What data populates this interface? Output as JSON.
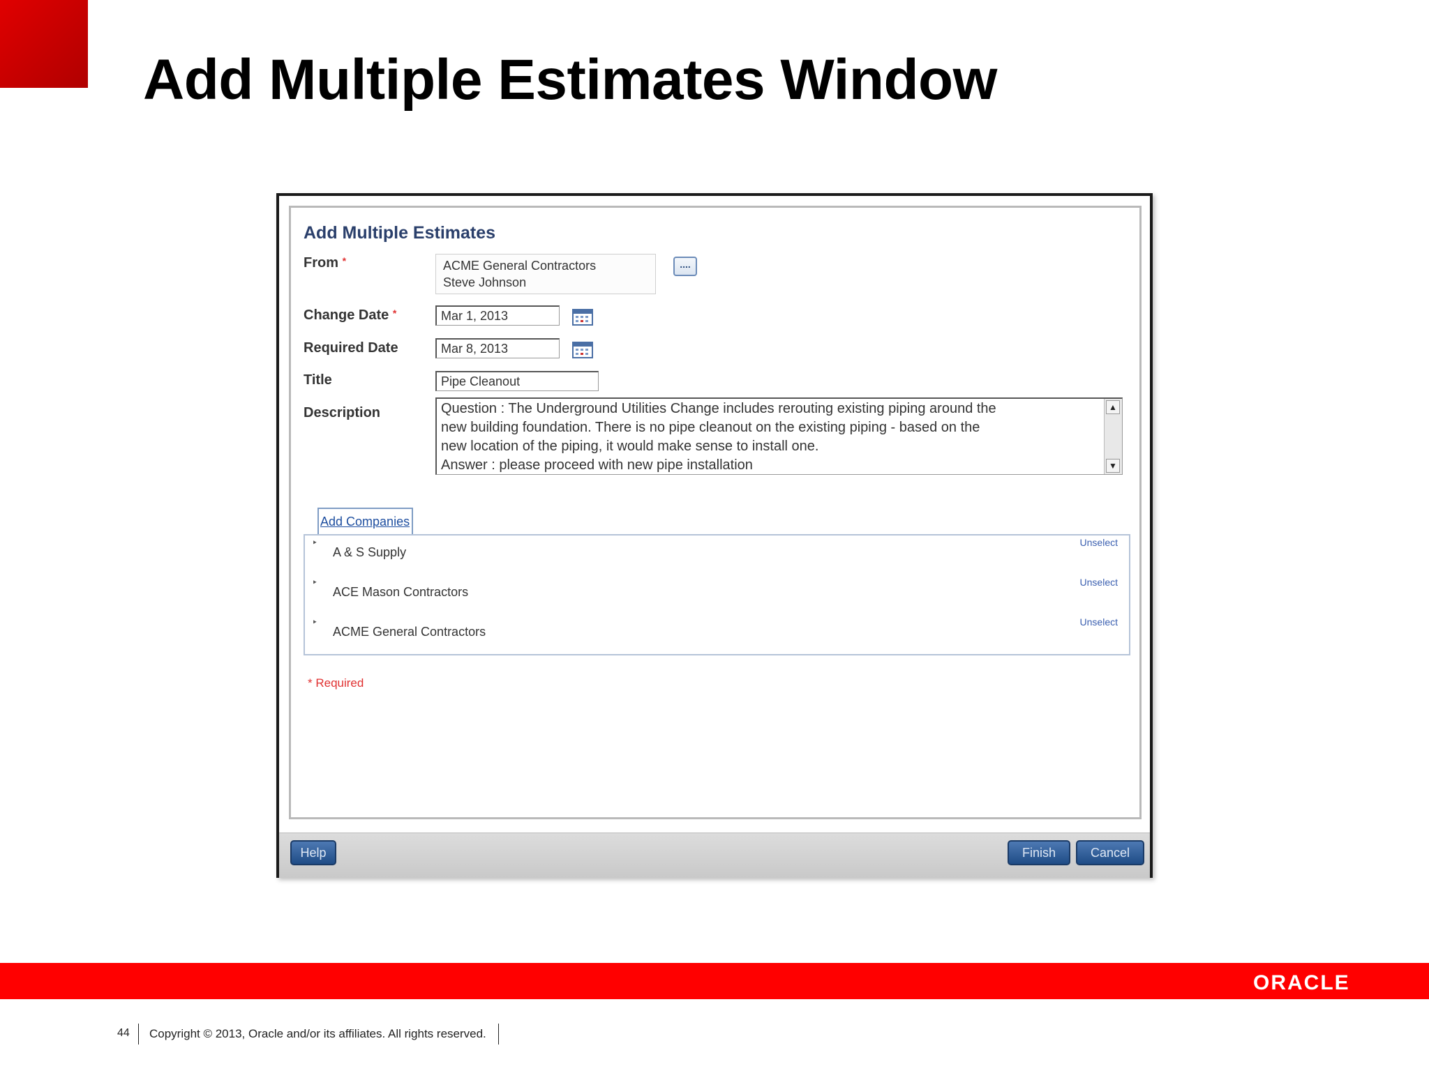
{
  "slide": {
    "title": "Add Multiple Estimates Window",
    "page_number": "44",
    "copyright": "Copyright © 2013, Oracle and/or its affiliates. All rights reserved.",
    "logo_text": "ORACLE",
    "brand_color": "#ff0000"
  },
  "window": {
    "title": "Add Multiple Estimates",
    "from": {
      "label": "From",
      "company": "ACME General Contractors",
      "contact": "Steve Johnson",
      "picker_label": "...."
    },
    "change_date": {
      "label": "Change Date",
      "value": "Mar 1, 2013"
    },
    "required_date": {
      "label": "Required Date",
      "value": "Mar 8, 2013"
    },
    "title_field": {
      "label": "Title",
      "value": "Pipe Cleanout"
    },
    "description": {
      "label": "Description",
      "line1": "Question : The Underground Utilities Change includes rerouting existing piping around the",
      "line2": "new building foundation.  There is no pipe cleanout on the existing piping - based on the",
      "line3": "new location of the piping, it would make sense to install one.",
      "line4": "Answer : please proceed with new pipe installation"
    },
    "add_companies_label": "Add Companies",
    "companies": [
      {
        "name": "A & S Supply",
        "action": "Unselect"
      },
      {
        "name": "ACE Mason Contractors",
        "action": "Unselect"
      },
      {
        "name": "ACME General Contractors",
        "action": "Unselect"
      }
    ],
    "required_note": "* Required",
    "required_marker": "*",
    "buttons": {
      "help": "Help",
      "finish": "Finish",
      "cancel": "Cancel"
    }
  }
}
